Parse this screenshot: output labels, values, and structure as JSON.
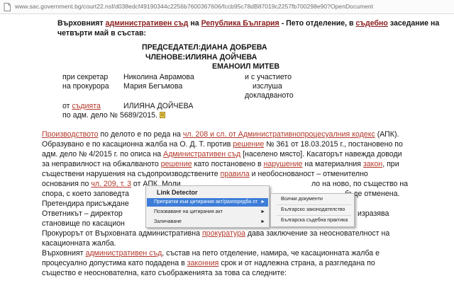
{
  "browser": {
    "url": "www.sac.government.bg/court22.nsf/d038edcf49190344c2256b7600367606/fccb95c78dB87019c2257fb700298e90?OpenDocument"
  },
  "document": {
    "intro": {
      "p1": "Върховният ",
      "p2": "административен съд",
      "p3": " на ",
      "p4": "Република България",
      "p5": " - Пето отделение, в ",
      "p6": "съдебно",
      "p7": " заседание на",
      "line2": "четвърти май в състав:"
    },
    "panel": {
      "chair": "ПРЕДСЕДАТЕЛ:ДИАНА ДОБРЕВА",
      "members": "ЧЛЕНОВЕ:ИЛИЯНА ДОЙЧЕВА",
      "member2": "ЕМАНОИЛ МИТЕВ"
    },
    "participants": {
      "secretary_label": "при секретар",
      "secretary_name": "Николина Аврамова",
      "and_with": "и с участието",
      "prosecutor_label": "на прокурора",
      "prosecutor_name": "Мария Бегъмова",
      "heard": "изслуша",
      "report": "докладваното",
      "from": "от ",
      "judge_word": "съдията",
      "judge_name": "ИЛИЯНА ДОЙЧЕВА",
      "case_ref": "по адм. дело № 5689/2015."
    },
    "body": {
      "l1_a": "Производството",
      "l1_b": " по делото е по реда на ",
      "l1_c": "чл. 208 и сл. от Административнопроцесуалния кодекс",
      "l1_d": " (АПК).",
      "l2_a": "Образувано е по касационна жалба на О. Д. Т. против ",
      "l2_b": "решение",
      "l2_c": " № 361 от 18.03.2015 г., постановено по",
      "l3_a": "адм. дело № 4/2015 г. по описа на ",
      "l3_b": "Административен съд",
      "l3_c": " [населено място]. Касаторът навежда доводи",
      "l4_a": "за неправилност на обжалваното ",
      "l4_b": "решение",
      "l4_c": " като постановено в ",
      "l4_d": "нарушение",
      "l4_e": " на материалния ",
      "l4_f": "закон",
      "l4_g": ", при",
      "l5_a": "съществени нарушения на съдопроизводствените ",
      "l5_b": "правила",
      "l5_c": " и необоснованост – отменително",
      "l6_a": "основания по ",
      "l6_b": "чл. 209, т. 3",
      "l6_c": " от АПК. Моли",
      "l6_d": "ло на ново, по същество на",
      "l7_a": "спора, с което заповедта",
      "l7_b": "бъде отменена.",
      "l8_a": "Претендира присъждане",
      "l9_a": "Ответникът – директор",
      "l9_b": "изразява",
      "l10_a": "становище по касацион",
      "l11_a": "Прокурорът от Върховната административна ",
      "l11_b": "прокуратура",
      "l11_c": " дава заключение за неоснователност на",
      "l12": "касационната жалба.",
      "l13_a": "Върховният ",
      "l13_b": "административен съд",
      "l13_c": ", състав на пето отделение, намира, че касационната жалба е",
      "l14_a": "процесуално допустима като подадена в ",
      "l14_b": "законния",
      "l14_c": " срок и от надлежна страна, а разгледана по",
      "l15": "същество е неоснователна, като съображенията за това са следните:"
    }
  },
  "context_menu": {
    "title": "Link Detector",
    "items": [
      "Препратки към цитирания акт/разпоредба от",
      "Позоваване на цитирания акт",
      "Заличаване"
    ],
    "arrow": "►"
  },
  "submenu": {
    "items": [
      "Всички документи",
      "Българско законодателство",
      "Българска съдебна практика"
    ]
  },
  "colors": {
    "accent_link": "#b3392b",
    "dark_red": "#8a1c1c",
    "menu_highlight": "#3d7dd8"
  }
}
